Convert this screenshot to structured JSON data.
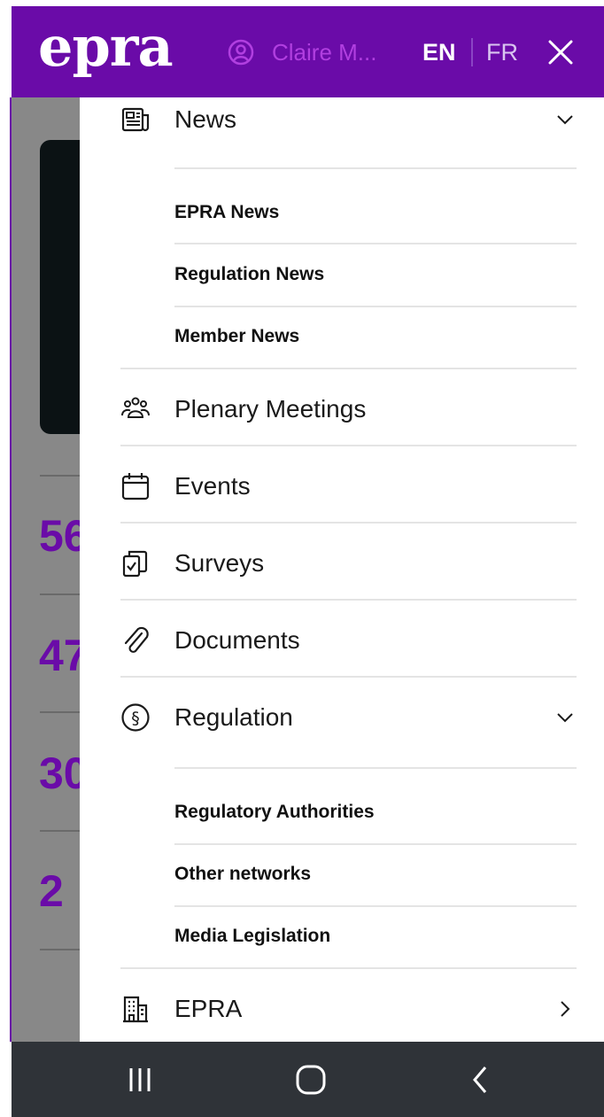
{
  "header": {
    "logo": "epra",
    "user_name": "Claire M...",
    "lang_active": "EN",
    "lang_other": "FR",
    "colors": {
      "brand": "#6a0ba8",
      "user": "#b13fe0"
    }
  },
  "background": {
    "stats": [
      "56",
      "47",
      "30",
      "2"
    ]
  },
  "menu": {
    "news": {
      "label": "News",
      "icon": "newspaper-icon",
      "expanded": true,
      "sub": [
        "EPRA News",
        "Regulation News",
        "Member News"
      ]
    },
    "plenary": {
      "label": "Plenary Meetings",
      "icon": "people-icon"
    },
    "events": {
      "label": "Events",
      "icon": "calendar-icon"
    },
    "surveys": {
      "label": "Surveys",
      "icon": "clipboard-check-icon"
    },
    "documents": {
      "label": "Documents",
      "icon": "paperclip-icon"
    },
    "regulation": {
      "label": "Regulation",
      "icon": "section-sign-icon",
      "expanded": true,
      "sub": [
        "Regulatory Authorities",
        "Other networks",
        "Media Legislation"
      ]
    },
    "epra": {
      "label": "EPRA",
      "icon": "building-icon"
    }
  }
}
